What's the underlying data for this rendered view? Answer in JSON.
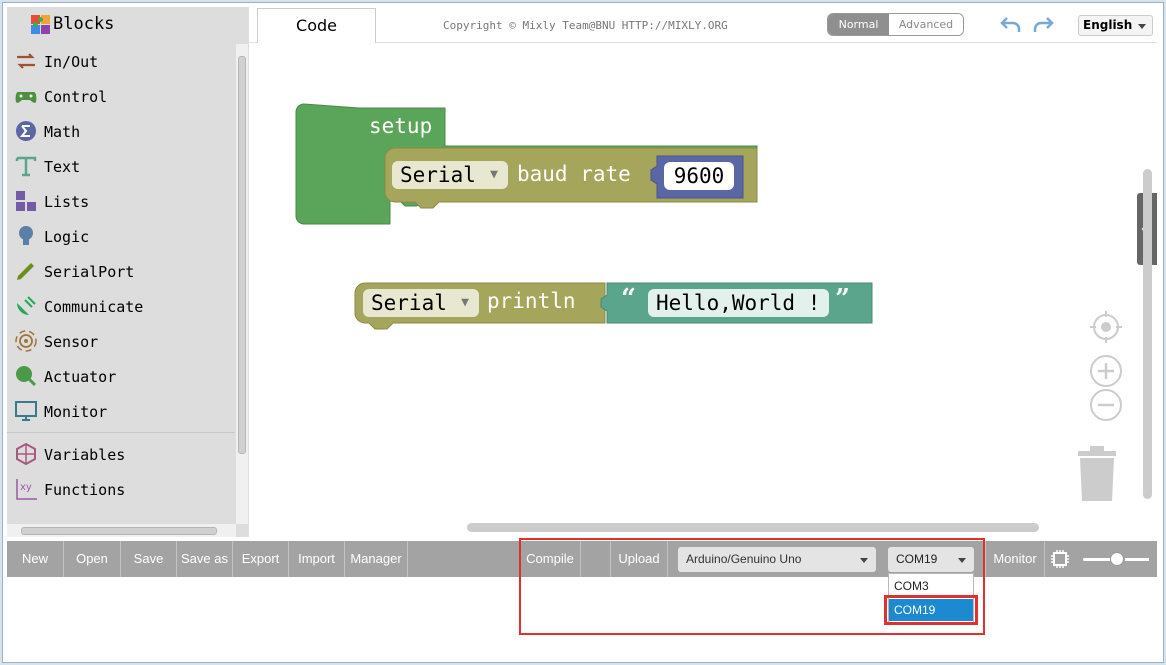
{
  "toolbox": {
    "title": "Blocks",
    "items": [
      {
        "label": "In/Out",
        "icon": "arrows-icon",
        "color": "#a0522d"
      },
      {
        "label": "Control",
        "icon": "gamepad-icon",
        "color": "#4d8f3f"
      },
      {
        "label": "Math",
        "icon": "sigma-icon",
        "color": "#5b67a5"
      },
      {
        "label": "Text",
        "icon": "text-t-icon",
        "color": "#5ba58c"
      },
      {
        "label": "Lists",
        "icon": "blocks-icon",
        "color": "#745ba5"
      },
      {
        "label": "Logic",
        "icon": "bulb-icon",
        "color": "#5b80a5"
      },
      {
        "label": "SerialPort",
        "icon": "pen-icon",
        "color": "#6a8f1f"
      },
      {
        "label": "Communicate",
        "icon": "satellite-icon",
        "color": "#26a65b"
      },
      {
        "label": "Sensor",
        "icon": "signal-icon",
        "color": "#a0743a"
      },
      {
        "label": "Actuator",
        "icon": "motor-icon",
        "color": "#4a9a4a"
      },
      {
        "label": "Monitor",
        "icon": "monitor-icon",
        "color": "#3a7a8a"
      },
      {
        "label": "Variables",
        "icon": "unity-icon",
        "color": "#a55b80"
      },
      {
        "label": "Functions",
        "icon": "function-xy-icon",
        "color": "#9a5ba5"
      }
    ]
  },
  "topbar": {
    "tab_code": "Code",
    "copyright": "Copyright © Mixly Team@BNU HTTP://MIXLY.ORG",
    "mode_normal": "Normal",
    "mode_advanced": "Advanced",
    "language": "English"
  },
  "blocks": {
    "setup_label": "setup",
    "serial_1": "Serial",
    "baud_label": "baud rate",
    "baud_value": "9600",
    "serial_2": "Serial",
    "println_label": "println",
    "string_value": "Hello,World !",
    "quote_open": "“",
    "quote_close": "”",
    "colors": {
      "setup": "#5ba55b",
      "serial": "#a5a55b",
      "text": "#5ba58c"
    }
  },
  "bottombar": {
    "new": "New",
    "open": "Open",
    "save": "Save",
    "save_as": "Save as",
    "export": "Export",
    "import": "Import",
    "manager": "Manager",
    "compile": "Compile",
    "upload": "Upload",
    "board": "Arduino/Genuino Uno",
    "port": "COM19",
    "monitor": "Monitor"
  },
  "port_dropdown": {
    "options": [
      "COM3",
      "COM19"
    ],
    "selected": "COM19"
  }
}
